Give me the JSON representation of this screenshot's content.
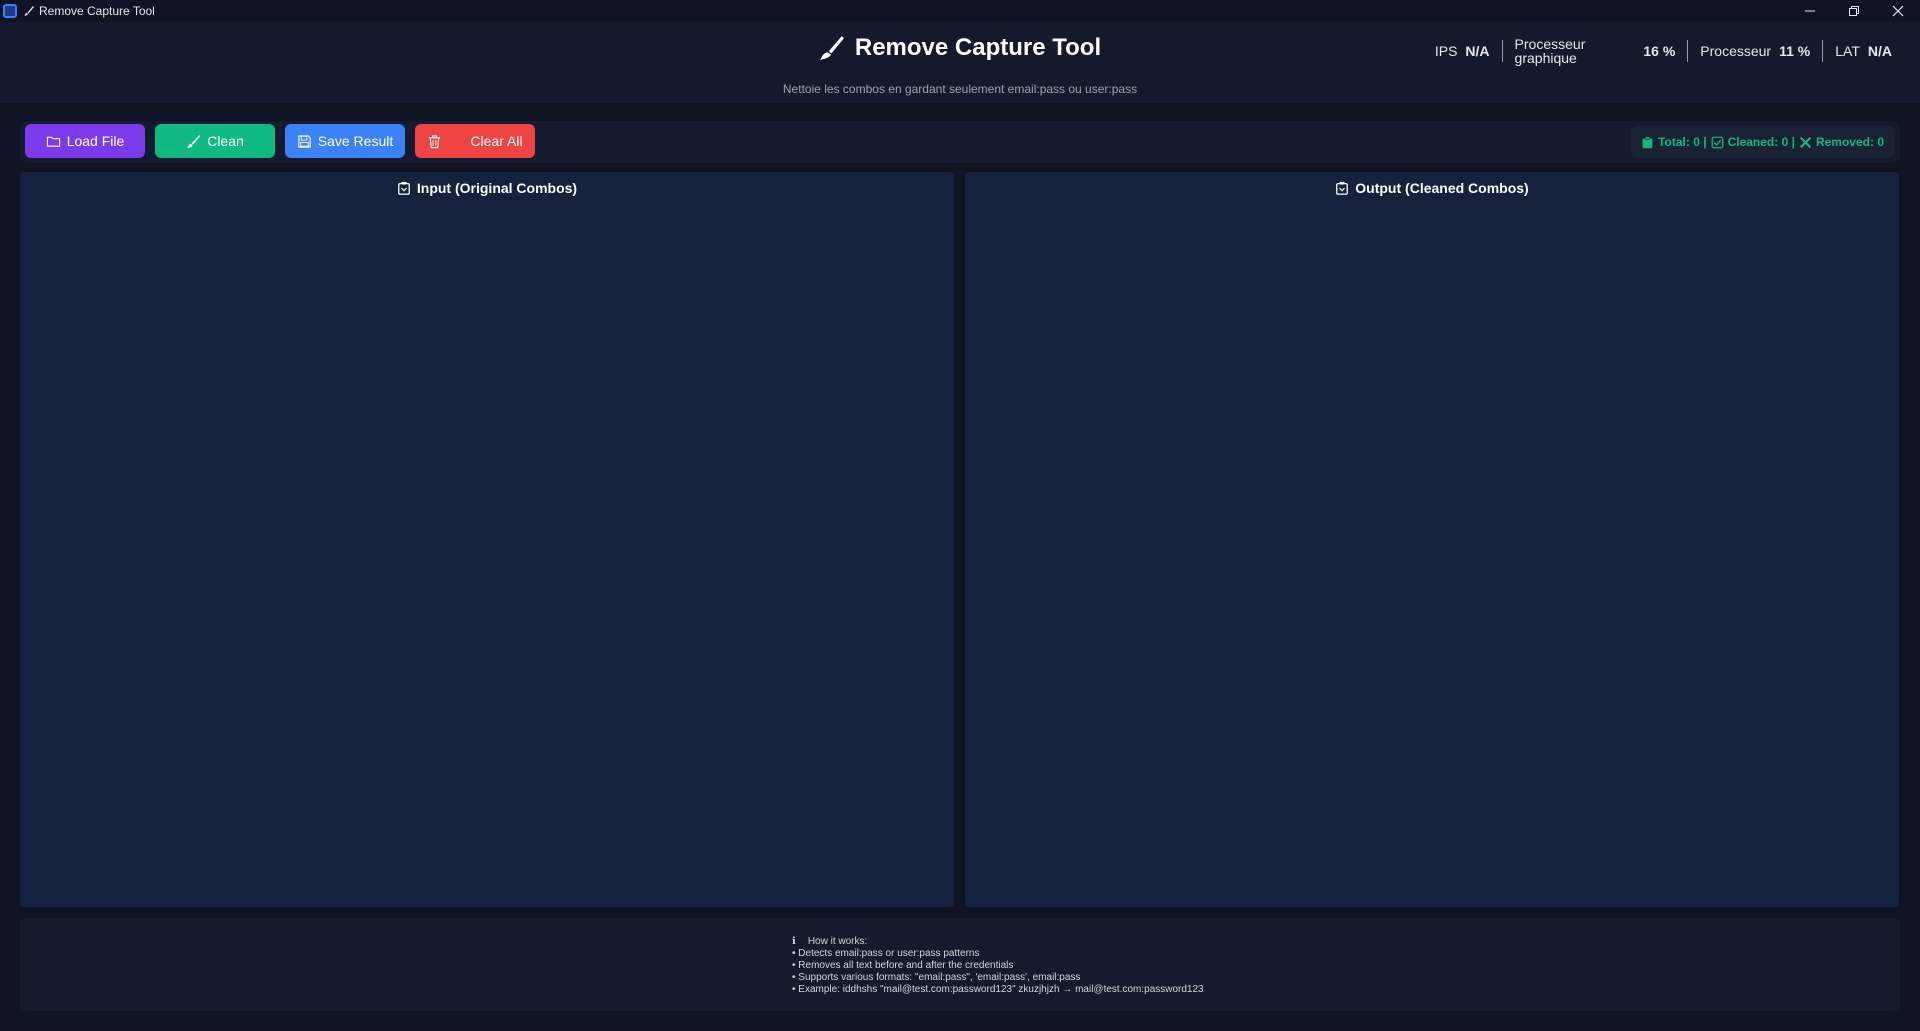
{
  "window": {
    "title": "Remove Capture Tool"
  },
  "header": {
    "title": "Remove Capture Tool",
    "subtitle": "Nettoie les combos en gardant seulement email:pass ou user:pass"
  },
  "perf": {
    "ips_label": "IPS",
    "ips_value": "N/A",
    "gpu_label_line1": "Processeur",
    "gpu_label_line2": "graphique",
    "gpu_value": "16 %",
    "cpu_label": "Processeur",
    "cpu_value": "11 %",
    "lat_label": "LAT",
    "lat_value": "N/A"
  },
  "toolbar": {
    "load_label": "Load File",
    "clean_label": "Clean",
    "save_label": "Save Result",
    "clear_label": "Clear All"
  },
  "stats": {
    "total": "Total: 0 |",
    "cleaned": "Cleaned: 0 |",
    "removed": "Removed: 0"
  },
  "panels": {
    "input_title": "Input (Original Combos)",
    "input_value": "",
    "output_title": "Output (Cleaned Combos)",
    "output_value": ""
  },
  "info": {
    "icon": "ℹ",
    "title": "How it works:",
    "lines": [
      "• Detects email:pass or user:pass patterns",
      "• Removes all text before and after the credentials",
      "• Supports various formats: \"email:pass\", 'email:pass', email:pass",
      "• Example: iddhshs \"mail@test.com:password123\" zkuzjhjzh → mail@test.com:password123"
    ]
  },
  "colors": {
    "background": "#0f1424",
    "panel": "#16213e",
    "load": "#7c3aed",
    "clean": "#10b981",
    "save": "#3b82f6",
    "clear": "#ef4444",
    "stats_text": "#10b981"
  },
  "icons": {
    "brush": "brush-icon",
    "folder": "folder-icon",
    "floppy": "floppy-icon",
    "trash": "trash-icon",
    "clipboard": "clipboard-icon",
    "check": "check-icon",
    "cross": "cross-icon"
  }
}
